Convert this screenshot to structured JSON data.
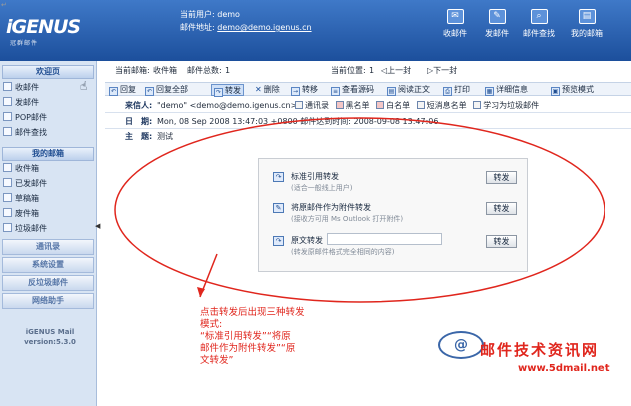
{
  "header": {
    "brand": "iGENUS",
    "brand_sub": "冠群邮件",
    "current_user_label": "当前用户:",
    "current_user": "demo",
    "mail_address_label": "邮件地址:",
    "mail_address": "demo@demo.igenus.cn",
    "buttons": [
      {
        "label": "收邮件",
        "icon": "inbox-icon"
      },
      {
        "label": "发邮件",
        "icon": "compose-icon"
      },
      {
        "label": "邮件查找",
        "icon": "search-icon"
      },
      {
        "label": "我的邮箱",
        "icon": "mailbox-icon"
      }
    ]
  },
  "sidebar": {
    "welcome": "欢迎页",
    "top_items": [
      "收邮件",
      "发邮件",
      "POP邮件",
      "邮件查找"
    ],
    "my_mailbox_title": "我的邮箱",
    "folders": [
      "收件箱",
      "已发邮件",
      "草稿箱",
      "废件箱",
      "垃圾邮件"
    ],
    "sections": [
      "通讯录",
      "系统设置",
      "反垃圾邮件",
      "网络助手"
    ],
    "version_line1": "iGENUS Mail",
    "version_line2": "version:5.3.0"
  },
  "main": {
    "infobar": {
      "mailbox_label": "当前邮箱:",
      "mailbox": "收件箱",
      "total_label": "邮件总数:",
      "total": "1",
      "position_label": "当前位置:",
      "position": "1",
      "prev": "上一封",
      "next": "下一封"
    },
    "toolbar": [
      {
        "label": "回复",
        "icon": "reply-icon"
      },
      {
        "label": "回复全部",
        "icon": "reply-all-icon"
      },
      {
        "label": "转发",
        "icon": "forward-icon"
      },
      {
        "label": "删除",
        "icon": "delete-icon"
      },
      {
        "label": "转移",
        "icon": "move-icon"
      },
      {
        "label": "查看源码",
        "icon": "source-icon"
      },
      {
        "label": "阅读正文",
        "icon": "read-icon"
      },
      {
        "label": "打印",
        "icon": "print-icon"
      },
      {
        "label": "详细信息",
        "icon": "details-icon"
      },
      {
        "label": "预览模式",
        "icon": "preview-icon"
      }
    ],
    "from_label": "来信人:",
    "from_value": "\"demo\" <demo@demo.igenus.cn>",
    "from_actions": [
      "通讯录",
      "黑名单",
      "白名单",
      "短消息名单",
      "学习为垃圾邮件"
    ],
    "date_label": "日　期:",
    "date_value": "Mon, 08 Sep 2008 13:47:03 +0800 邮件达到时间: 2008-09-08 13:47:06",
    "subject_label": "主　题:",
    "subject_value": "测试"
  },
  "forward_options": [
    {
      "title": "标准引用转发",
      "desc": "(适合一般线上用户)",
      "button": "转发"
    },
    {
      "title": "将原邮件作为附件转发",
      "desc": "(接收方可用 Ms Outlook 打开附件)",
      "button": "转发"
    },
    {
      "title": "原文转发",
      "desc": "(转发原邮件格式完全相同的内容)",
      "button": "转发"
    }
  ],
  "annotation": {
    "line1": "点击转发后出现三种转发",
    "line2": "模式:",
    "line3": "“标准引用转发”“将原",
    "line4": "邮件作为附件转发”“原",
    "line5": "文转发”"
  },
  "watermark": {
    "logo": "@",
    "text": "邮件技术资讯网",
    "url": "www.5dmail.net"
  },
  "colors": {
    "header_blue": "#1c4f9c",
    "annotation_red": "#e0261d",
    "sidebar_bg": "#d8e4f3"
  }
}
